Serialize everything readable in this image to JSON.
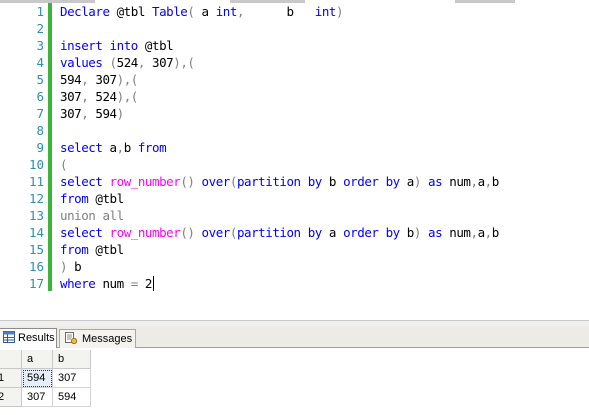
{
  "editor": {
    "line_numbers": [
      "1",
      "2",
      "3",
      "4",
      "5",
      "6",
      "7",
      "8",
      "9",
      "10",
      "11",
      "12",
      "13",
      "14",
      "15",
      "16",
      "17"
    ],
    "lines": [
      [
        {
          "c": "k",
          "t": "Declare"
        },
        {
          "c": "t",
          "t": " @tbl "
        },
        {
          "c": "k",
          "t": "Table"
        },
        {
          "c": "g",
          "t": "("
        },
        {
          "c": "t",
          "t": " a "
        },
        {
          "c": "k",
          "t": "int"
        },
        {
          "c": "g",
          "t": ","
        },
        {
          "c": "t",
          "t": "      b   "
        },
        {
          "c": "k",
          "t": "int"
        },
        {
          "c": "g",
          "t": ")"
        }
      ],
      [],
      [
        {
          "c": "k",
          "t": "insert"
        },
        {
          "c": "t",
          "t": " "
        },
        {
          "c": "k",
          "t": "into"
        },
        {
          "c": "t",
          "t": " @tbl"
        }
      ],
      [
        {
          "c": "k",
          "t": "values"
        },
        {
          "c": "t",
          "t": " "
        },
        {
          "c": "g",
          "t": "("
        },
        {
          "c": "t",
          "t": "524"
        },
        {
          "c": "g",
          "t": ","
        },
        {
          "c": "t",
          "t": " 307"
        },
        {
          "c": "g",
          "t": "),("
        }
      ],
      [
        {
          "c": "t",
          "t": "594"
        },
        {
          "c": "g",
          "t": ","
        },
        {
          "c": "t",
          "t": " 307"
        },
        {
          "c": "g",
          "t": "),("
        }
      ],
      [
        {
          "c": "t",
          "t": "307"
        },
        {
          "c": "g",
          "t": ","
        },
        {
          "c": "t",
          "t": " 524"
        },
        {
          "c": "g",
          "t": "),("
        }
      ],
      [
        {
          "c": "t",
          "t": "307"
        },
        {
          "c": "g",
          "t": ","
        },
        {
          "c": "t",
          "t": " 594"
        },
        {
          "c": "g",
          "t": ")"
        }
      ],
      [],
      [
        {
          "c": "k",
          "t": "select"
        },
        {
          "c": "t",
          "t": " a"
        },
        {
          "c": "g",
          "t": ","
        },
        {
          "c": "t",
          "t": "b "
        },
        {
          "c": "k",
          "t": "from"
        }
      ],
      [
        {
          "c": "g",
          "t": "("
        }
      ],
      [
        {
          "c": "k",
          "t": "select"
        },
        {
          "c": "t",
          "t": " "
        },
        {
          "c": "f",
          "t": "row_number"
        },
        {
          "c": "g",
          "t": "()"
        },
        {
          "c": "t",
          "t": " "
        },
        {
          "c": "k",
          "t": "over"
        },
        {
          "c": "g",
          "t": "("
        },
        {
          "c": "k",
          "t": "partition"
        },
        {
          "c": "t",
          "t": " "
        },
        {
          "c": "k",
          "t": "by"
        },
        {
          "c": "t",
          "t": " b "
        },
        {
          "c": "k",
          "t": "order"
        },
        {
          "c": "t",
          "t": " "
        },
        {
          "c": "k",
          "t": "by"
        },
        {
          "c": "t",
          "t": " a"
        },
        {
          "c": "g",
          "t": ")"
        },
        {
          "c": "t",
          "t": " "
        },
        {
          "c": "k",
          "t": "as"
        },
        {
          "c": "t",
          "t": " num"
        },
        {
          "c": "g",
          "t": ","
        },
        {
          "c": "t",
          "t": "a"
        },
        {
          "c": "g",
          "t": ","
        },
        {
          "c": "t",
          "t": "b"
        }
      ],
      [
        {
          "c": "k",
          "t": "from"
        },
        {
          "c": "t",
          "t": " @tbl"
        }
      ],
      [
        {
          "c": "g",
          "t": "union"
        },
        {
          "c": "t",
          "t": " "
        },
        {
          "c": "g",
          "t": "all"
        }
      ],
      [
        {
          "c": "k",
          "t": "select"
        },
        {
          "c": "t",
          "t": " "
        },
        {
          "c": "f",
          "t": "row_number"
        },
        {
          "c": "g",
          "t": "()"
        },
        {
          "c": "t",
          "t": " "
        },
        {
          "c": "k",
          "t": "over"
        },
        {
          "c": "g",
          "t": "("
        },
        {
          "c": "k",
          "t": "partition"
        },
        {
          "c": "t",
          "t": " "
        },
        {
          "c": "k",
          "t": "by"
        },
        {
          "c": "t",
          "t": " a "
        },
        {
          "c": "k",
          "t": "order"
        },
        {
          "c": "t",
          "t": " "
        },
        {
          "c": "k",
          "t": "by"
        },
        {
          "c": "t",
          "t": " b"
        },
        {
          "c": "g",
          "t": ")"
        },
        {
          "c": "t",
          "t": " "
        },
        {
          "c": "k",
          "t": "as"
        },
        {
          "c": "t",
          "t": " num"
        },
        {
          "c": "g",
          "t": ","
        },
        {
          "c": "t",
          "t": "a"
        },
        {
          "c": "g",
          "t": ","
        },
        {
          "c": "t",
          "t": "b"
        }
      ],
      [
        {
          "c": "k",
          "t": "from"
        },
        {
          "c": "t",
          "t": " @tbl"
        }
      ],
      [
        {
          "c": "g",
          "t": ")"
        },
        {
          "c": "t",
          "t": " b"
        }
      ],
      [
        {
          "c": "k",
          "t": "where"
        },
        {
          "c": "t",
          "t": " num "
        },
        {
          "c": "g",
          "t": "="
        },
        {
          "c": "t",
          "t": " 2"
        }
      ]
    ],
    "colors": {
      "keyword": "#0000ff",
      "function": "#ff00ff",
      "operator": "#808080",
      "text": "#000000",
      "line_number": "#2b91af",
      "change_bar": "#3cb43c"
    }
  },
  "tabs": {
    "results_label": "Results",
    "results_icon": "grid-icon",
    "messages_label": "Messages",
    "messages_icon": "messages-icon"
  },
  "grid": {
    "columns": [
      "a",
      "b"
    ],
    "row_numbers": [
      "1",
      "2"
    ],
    "rows": [
      [
        "594",
        "307"
      ],
      [
        "307",
        "594"
      ]
    ],
    "selected_cell": "594"
  }
}
